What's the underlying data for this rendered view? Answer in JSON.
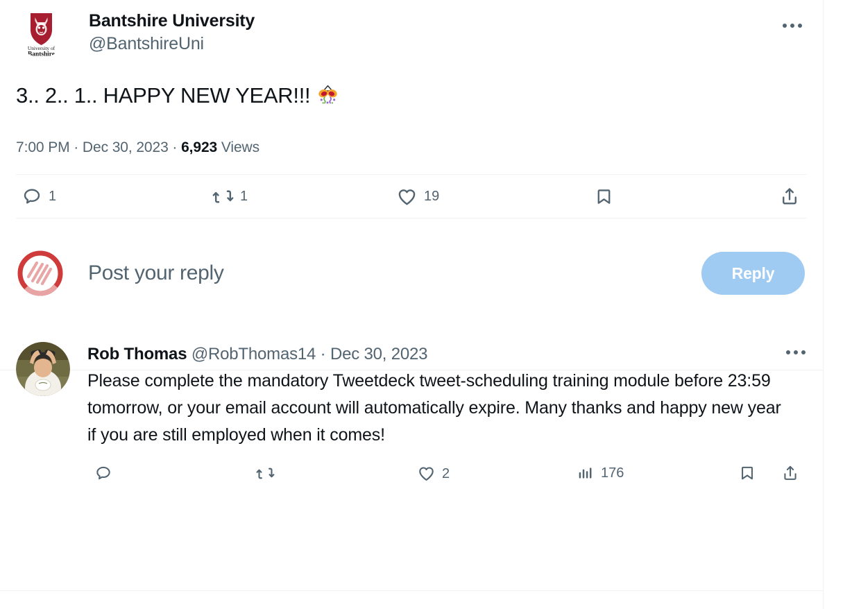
{
  "focal_tweet": {
    "author": {
      "display_name": "Bantshire University",
      "handle": "@BantshireUni",
      "avatar_alt": "university-crest-logo",
      "crest_text_line1": "University of",
      "crest_text_line2": "Bantshire",
      "crest_color": "#a61e2f"
    },
    "text": "3.. 2.. 1.. HAPPY NEW YEAR!!!",
    "emoji": "confetti-ball",
    "meta": {
      "time": "7:00 PM",
      "separator": "·",
      "date": "Dec 30, 2023",
      "views_count": "6,923",
      "views_label": "Views"
    },
    "more_menu_label": "More",
    "actions": [
      {
        "name": "reply",
        "icon": "reply-icon",
        "count": "1"
      },
      {
        "name": "retweet",
        "icon": "retweet-icon",
        "count": "1"
      },
      {
        "name": "like",
        "icon": "heart-icon",
        "count": "19"
      },
      {
        "name": "bookmark",
        "icon": "bookmark-icon",
        "count": ""
      },
      {
        "name": "share",
        "icon": "share-icon",
        "count": ""
      }
    ]
  },
  "composer": {
    "avatar_alt": "user-logo-avatar",
    "placeholder": "Post your reply",
    "reply_button_label": "Reply",
    "reply_button_color": "#9fcbf2"
  },
  "reply": {
    "author": {
      "display_name": "Rob Thomas",
      "handle": "@RobThomas14",
      "avatar_alt": "person-with-binoculars-photo"
    },
    "separator": "·",
    "date": "Dec 30, 2023",
    "text": "Please complete the mandatory Tweetdeck tweet-scheduling training module before 23:59 tomorrow, or your email account will automatically expire. Many thanks and happy new year if you are still employed when it comes!",
    "more_menu_label": "More",
    "actions": [
      {
        "name": "reply",
        "icon": "reply-icon",
        "count": ""
      },
      {
        "name": "retweet",
        "icon": "retweet-icon",
        "count": ""
      },
      {
        "name": "like",
        "icon": "heart-icon",
        "count": "2"
      },
      {
        "name": "views",
        "icon": "analytics-icon",
        "count": "176"
      },
      {
        "name": "bookmark",
        "icon": "bookmark-icon",
        "count": ""
      },
      {
        "name": "share",
        "icon": "share-icon",
        "count": ""
      }
    ]
  },
  "theme": {
    "text_primary": "#0f1419",
    "text_secondary": "#536471",
    "divider": "#eff3f4",
    "background": "#ffffff"
  }
}
